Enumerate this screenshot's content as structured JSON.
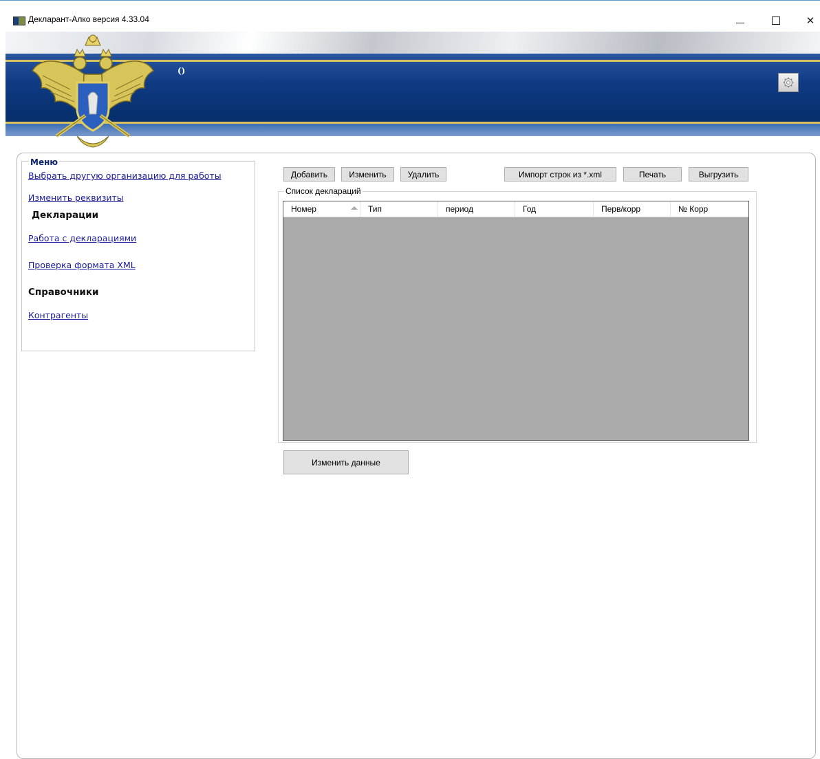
{
  "window": {
    "title": "Декларант-Алко версия 4.33.04",
    "minimize_icon": "minimize-icon",
    "maximize_icon": "maximize-icon",
    "close_icon": "close-icon",
    "close_glyph": "✕"
  },
  "banner": {
    "org_text": "()",
    "emblem_icon": "double-headed-eagle-emblem",
    "settings_icon": "gear-icon",
    "colors": {
      "blue": "#0f3b84",
      "gold": "#d8c05a"
    }
  },
  "menu": {
    "title": "Меню",
    "links_top": [
      "Выбрать другую организацию для работы",
      "Изменить реквизиты"
    ],
    "section_declarations": "Декларации",
    "links_declarations": [
      "Работа с декларациями",
      "Проверка формата XML"
    ],
    "section_references": "Справочники",
    "links_references": [
      "Контрагенты"
    ]
  },
  "toolbar": {
    "add": "Добавить",
    "edit": "Изменить",
    "delete": "Удалить",
    "import": "Импорт строк из *.xml",
    "print": "Печать",
    "export": "Выгрузить"
  },
  "declarations": {
    "group_label": "Список деклараций",
    "columns": [
      "Номер",
      "Тип",
      "период",
      "Год",
      "Перв/корр",
      "№ Корр"
    ],
    "sorted_column": "Номер",
    "rows": [],
    "grid_background": "#ababab"
  },
  "actions": {
    "change_data": "Изменить данные"
  }
}
